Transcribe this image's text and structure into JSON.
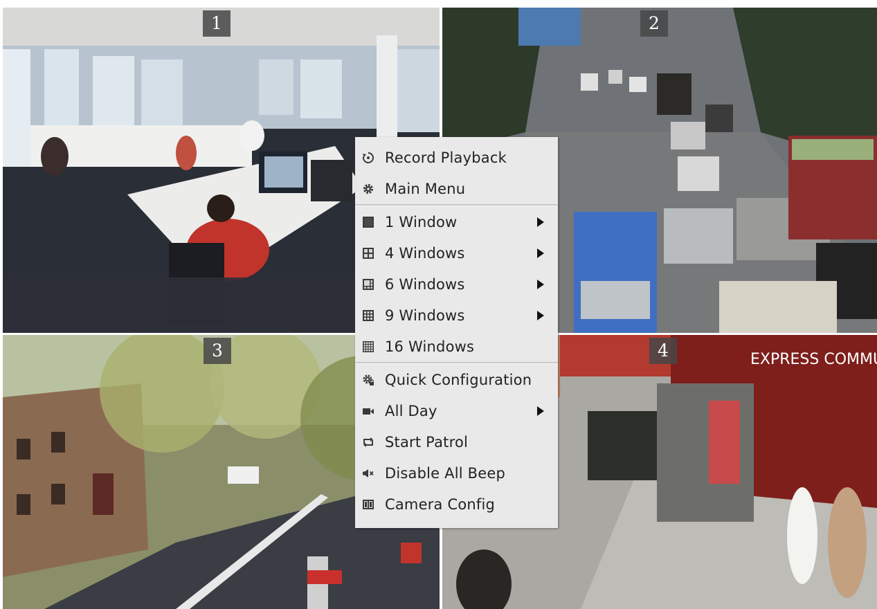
{
  "channels": [
    {
      "label": "1"
    },
    {
      "label": "2"
    },
    {
      "label": "3"
    },
    {
      "label": "4"
    }
  ],
  "context_menu": {
    "items": [
      {
        "label": "Record Playback",
        "icon": "playback-icon"
      },
      {
        "label": "Main Menu",
        "icon": "gear-icon"
      },
      {
        "label": "1 Window",
        "icon": "one-window-icon",
        "submenu": true
      },
      {
        "label": "4 Windows",
        "icon": "four-windows-icon",
        "submenu": true
      },
      {
        "label": "6 Windows",
        "icon": "six-windows-icon",
        "submenu": true
      },
      {
        "label": "9 Windows",
        "icon": "nine-windows-icon",
        "submenu": true
      },
      {
        "label": "16 Windows",
        "icon": "sixteen-windows-icon"
      },
      {
        "label": "Quick Configuration",
        "icon": "quick-config-icon"
      },
      {
        "label": "All Day",
        "icon": "video-camera-icon",
        "submenu": true
      },
      {
        "label": "Start Patrol",
        "icon": "patrol-icon"
      },
      {
        "label": "Disable All Beep",
        "icon": "mute-icon"
      },
      {
        "label": "Camera Config",
        "icon": "camera-config-icon"
      }
    ]
  }
}
